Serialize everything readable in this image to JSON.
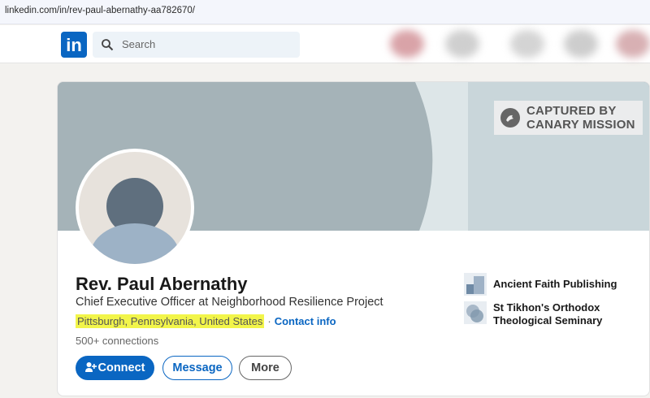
{
  "browser": {
    "url": "linkedin.com/in/rev-paul-abernathy-aa782670/"
  },
  "nav": {
    "logo_text": "in",
    "search_placeholder": "Search"
  },
  "watermark": {
    "line1": "CAPTURED BY",
    "line2": "CANARY MISSION"
  },
  "profile": {
    "name": "Rev. Paul Abernathy",
    "headline": "Chief Executive Officer at Neighborhood Resilience Project",
    "location": "Pittsburgh, Pennsylvania, United States",
    "separator": "·",
    "contact_info": "Contact info",
    "connections": "500+ connections"
  },
  "actions": {
    "connect": "Connect",
    "message": "Message",
    "more": "More"
  },
  "organizations": [
    {
      "name": "Ancient Faith Publishing",
      "icon": "publisher-logo"
    },
    {
      "name_line1": "St Tikhon's Orthodox",
      "name_line2": "Theological Seminary",
      "icon": "seminary-logo"
    }
  ],
  "colors": {
    "brand": "#0a66c2",
    "highlight": "#f2f54a"
  }
}
